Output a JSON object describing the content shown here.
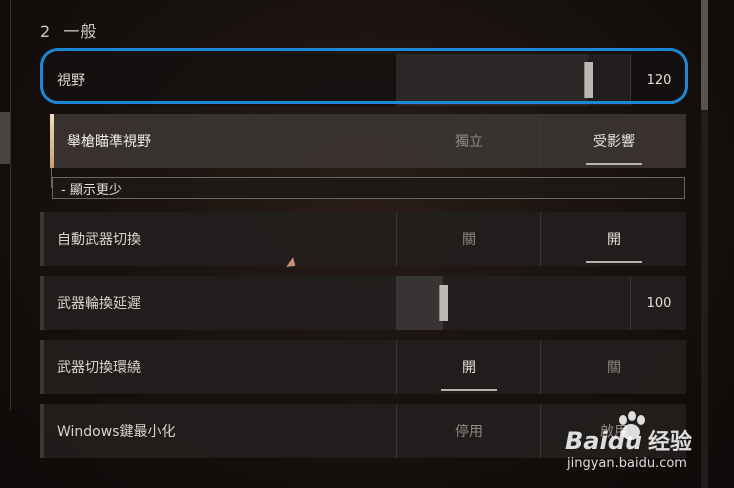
{
  "section": {
    "number": "2",
    "title": "一般"
  },
  "settings": {
    "fov": {
      "label": "視野",
      "value": "120",
      "fill_fraction": 0.82
    },
    "ads_fov": {
      "label": "舉槍瞄準視野",
      "options": [
        "獨立",
        "受影響"
      ],
      "selected_index": 1
    },
    "show_less": "- 顯示更少",
    "auto_weapon_switch": {
      "label": "自動武器切換",
      "options": [
        "關",
        "開"
      ],
      "selected_index": 1
    },
    "weapon_cycle_delay": {
      "label": "武器輪換延遲",
      "value": "100",
      "fill_fraction": 0.2
    },
    "weapon_switch_wrap": {
      "label": "武器切換環繞",
      "options": [
        "開",
        "關"
      ],
      "selected_index": 0
    },
    "windows_key_minimize": {
      "label": "Windows鍵最小化",
      "options": [
        "停用",
        "啟用"
      ],
      "selected_index": 1
    }
  },
  "colors": {
    "highlight": "#1e88d6",
    "accent_active": "#e9d2a6"
  },
  "watermark": {
    "brand": "Baidu",
    "brand_cn": "经验",
    "url": "jingyan.baidu.com"
  }
}
